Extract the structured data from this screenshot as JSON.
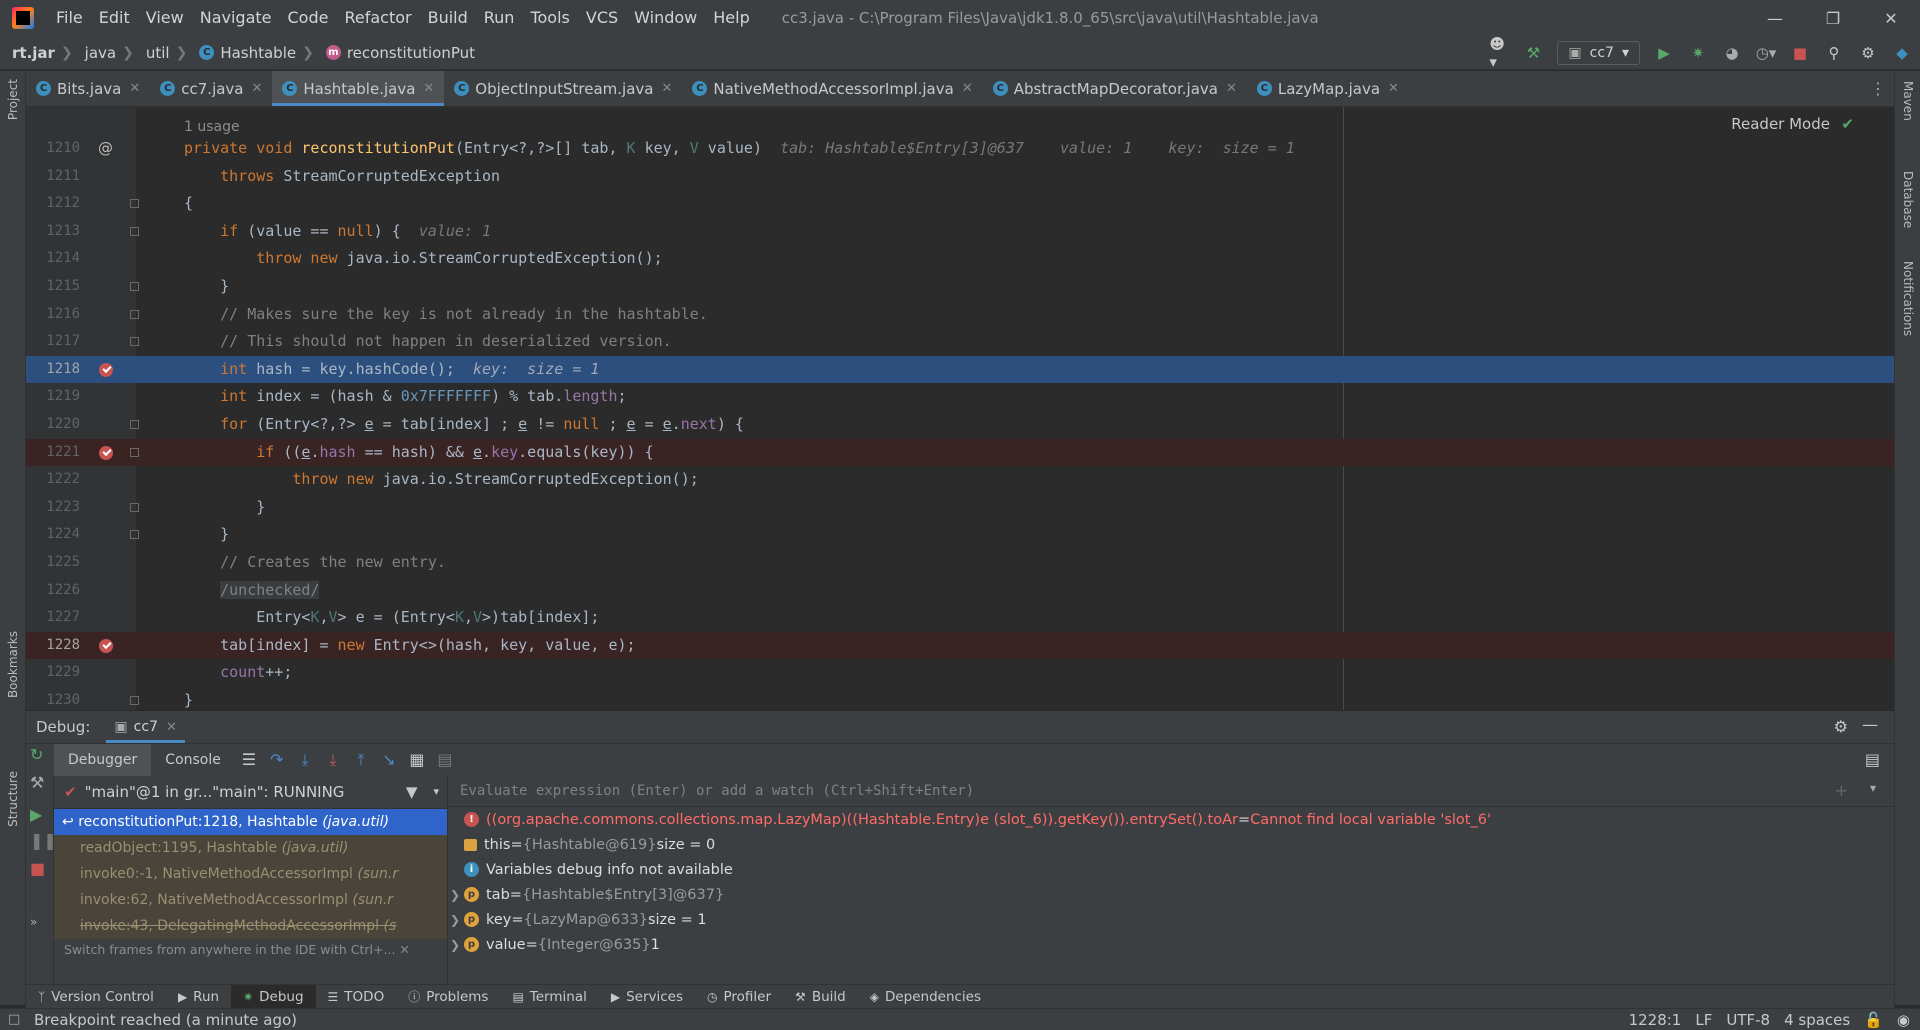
{
  "menu": [
    "File",
    "Edit",
    "View",
    "Navigate",
    "Code",
    "Refactor",
    "Build",
    "Run",
    "Tools",
    "VCS",
    "Window",
    "Help"
  ],
  "window_title": "cc3.java - C:\\Program Files\\Java\\jdk1.8.0_65\\src\\java\\util\\Hashtable.java",
  "breadcrumb": [
    "rt.jar",
    "java",
    "util",
    "Hashtable",
    "reconstitutionPut"
  ],
  "run_config": "cc7",
  "tabs": [
    "Bits.java",
    "cc7.java",
    "Hashtable.java",
    "ObjectInputStream.java",
    "NativeMethodAccessorImpl.java",
    "AbstractMapDecorator.java",
    "LazyMap.java"
  ],
  "active_tab": "Hashtable.java",
  "left_stripe": {
    "project": "Project",
    "bookmarks": "Bookmarks",
    "structure": "Structure"
  },
  "right_stripe": {
    "maven": "Maven",
    "database": "Database",
    "notifications": "Notifications"
  },
  "editor": {
    "usage_hint": "1 usage",
    "reader_mode": "Reader Mode",
    "line_numbers": [
      "1210",
      "1211",
      "1212",
      "1213",
      "1214",
      "1215",
      "1216",
      "1217",
      "1218",
      "1219",
      "1220",
      "1221",
      "1222",
      "1223",
      "1224",
      "1225",
      "1226",
      "1227",
      "1228",
      "1229",
      "1230"
    ],
    "inline_values": {
      "l1210": "tab: Hashtable$Entry[3]@637    value: 1    key:  size = 1",
      "l1213": "value: 1",
      "l1218": "key:  size = 1"
    },
    "comments": {
      "l1216": "// Makes sure the key is not already in the hashtable.",
      "l1217": "// This should not happen in deserialized version.",
      "l1225": "// Creates the new entry.",
      "l1226": "/unchecked/"
    }
  },
  "debug": {
    "title": "Debug:",
    "session": "cc7",
    "tabs": [
      "Debugger",
      "Console"
    ],
    "thread": "\"main\"@1 in gr...\"main\": RUNNING",
    "frames": [
      {
        "method": "reconstitutionPut:1218, Hashtable",
        "pkg": "(java.util)"
      },
      {
        "method": "readObject:1195, Hashtable",
        "pkg": "(java.util)"
      },
      {
        "method": "invoke0:-1, NativeMethodAccessorImpl",
        "pkg": "(sun.r"
      },
      {
        "method": "invoke:62, NativeMethodAccessorImpl",
        "pkg": "(sun.r"
      },
      {
        "method": "invoke:43, DelegatingMethodAccessorImpl",
        "pkg": "(s"
      }
    ],
    "frames_hint": "Switch frames from anywhere in the IDE with Ctrl+...",
    "eval_placeholder": "Evaluate expression (Enter) or add a watch (Ctrl+Shift+Enter)",
    "variables": [
      {
        "kind": "error",
        "name": "((org.apache.commons.collections.map.LazyMap)((Hashtable.Entry)e (slot_6)).getKey()).entrySet().toAr",
        "eq": " = ",
        "value": "Cannot find local variable 'slot_6'"
      },
      {
        "kind": "this",
        "name": "this",
        "eq": " = ",
        "ref": "{Hashtable@619}",
        "value": " size = 0"
      },
      {
        "kind": "info",
        "name": "Variables debug info not available"
      },
      {
        "kind": "field",
        "name": "tab",
        "eq": " = ",
        "ref": "{Hashtable$Entry[3]@637}"
      },
      {
        "kind": "field",
        "name": "key",
        "eq": " = ",
        "ref": "{LazyMap@633}",
        "value": " size = 1"
      },
      {
        "kind": "field",
        "name": "value",
        "eq": " = ",
        "ref": "{Integer@635}",
        "value": " 1"
      }
    ]
  },
  "bottom_tools": [
    "Version Control",
    "Run",
    "Debug",
    "TODO",
    "Problems",
    "Terminal",
    "Services",
    "Profiler",
    "Build",
    "Dependencies"
  ],
  "status": {
    "message": "Breakpoint reached (a minute ago)",
    "position": "1228:1",
    "line_sep": "LF",
    "encoding": "UTF-8",
    "indent": "4 spaces"
  }
}
